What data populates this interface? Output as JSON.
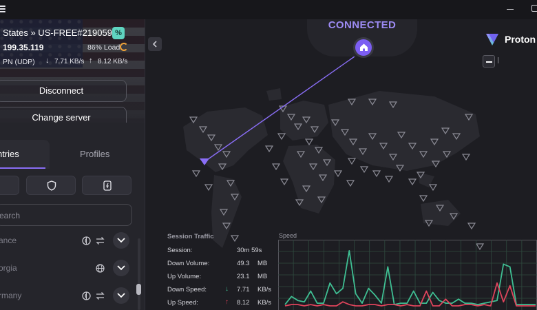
{
  "window": {
    "menu_icon": "hamburger-icon"
  },
  "connection": {
    "server_name": "States » US-FREE#219059",
    "ip": "199.35.119",
    "load": "86% Load",
    "protocol": "PN (UDP)",
    "down_rate": "7.71 KB/s",
    "up_rate": "8.12 KB/s",
    "tag_glyph": "%"
  },
  "actions": {
    "disconnect": "Disconnect",
    "change_server": "Change server"
  },
  "tabs": {
    "countries": "ntries",
    "profiles": "Profiles"
  },
  "search": {
    "placeholder": "earch"
  },
  "countries": [
    {
      "name": "ance"
    },
    {
      "name": "orgia"
    },
    {
      "name": "rmany"
    }
  ],
  "status": {
    "connected": "CONNECTED"
  },
  "brand": {
    "name": "Proton"
  },
  "traffic": {
    "title": "Session Traffic",
    "rows": [
      {
        "label": "Session:",
        "value": "30m 59s",
        "unit": ""
      },
      {
        "label": "Down Volume:",
        "value": "49.3",
        "unit": "MB"
      },
      {
        "label": "Up Volume:",
        "value": "23.1",
        "unit": "MB"
      },
      {
        "label": "Down Speed:",
        "value": "7.71",
        "unit": "KB/s"
      },
      {
        "label": "Up Speed:",
        "value": "8.12",
        "unit": "KB/s"
      }
    ],
    "speed_label": "Speed"
  },
  "colors": {
    "accent": "#8a6ef7",
    "down": "#3fbf93",
    "up": "#e0445c",
    "load": "#f1a33a"
  },
  "chart_data": {
    "type": "line",
    "series": [
      {
        "values": [
          2,
          8,
          5,
          4,
          12,
          3,
          3,
          18,
          10,
          14,
          42,
          10,
          3,
          14,
          9,
          3,
          30,
          2,
          3,
          3,
          12,
          3,
          3,
          11,
          5,
          3,
          3,
          6,
          3,
          3,
          2,
          3,
          4,
          5,
          32,
          30,
          2,
          2,
          2,
          2
        ]
      },
      {
        "values": [
          1,
          2,
          2,
          1,
          2,
          1,
          2,
          1,
          1,
          4,
          2,
          1,
          1,
          2,
          2,
          1,
          2,
          2,
          1,
          2,
          1,
          1,
          12,
          1,
          1,
          6,
          1,
          1,
          2,
          2,
          1,
          2,
          1,
          18,
          4,
          16,
          1,
          1,
          1,
          1
        ]
      }
    ]
  }
}
